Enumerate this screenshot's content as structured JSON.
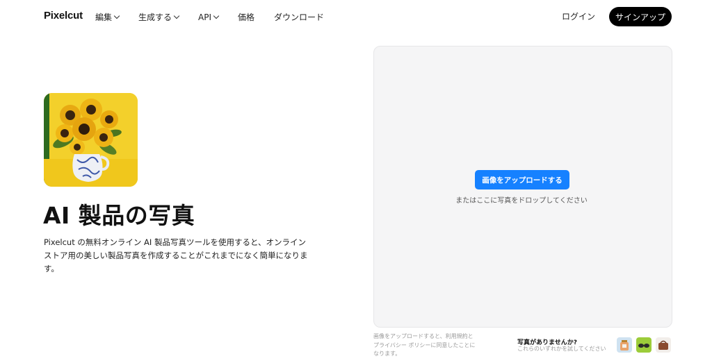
{
  "nav": {
    "logo": "Pixelcut",
    "menu": [
      {
        "label": "編集",
        "has_dropdown": true
      },
      {
        "label": "生成する",
        "has_dropdown": true
      },
      {
        "label": "API",
        "has_dropdown": true
      },
      {
        "label": "価格",
        "has_dropdown": false
      },
      {
        "label": "ダウンロード",
        "has_dropdown": false
      }
    ],
    "login_label": "ログイン",
    "signup_label": "サインアップ"
  },
  "hero": {
    "image_icon": "sunflower-vase-image",
    "title": "AI 製品の写真",
    "description": "Pixelcut の無料オンライン AI 製品写真ツールを使用すると、オンライン ストア用の美しい製品写真を作成することがこれまでになく簡単になります。"
  },
  "upload": {
    "button_label": "画像をアップロードする",
    "drop_hint": "またはここに写真をドロップしてください",
    "terms": "画像をアップロードすると、利用規約とプライバシー ポリシーに同意したことになります。",
    "no_image_title": "写真がありませんか?",
    "no_image_sub": "これらのいずれかを試してください",
    "samples": [
      "perfume-bottle-sample",
      "sunglasses-sample",
      "handbag-sample"
    ]
  },
  "colors": {
    "accent": "#1681ff",
    "signup_bg": "#000000",
    "hero_image_bg": "#f2cf2a"
  }
}
